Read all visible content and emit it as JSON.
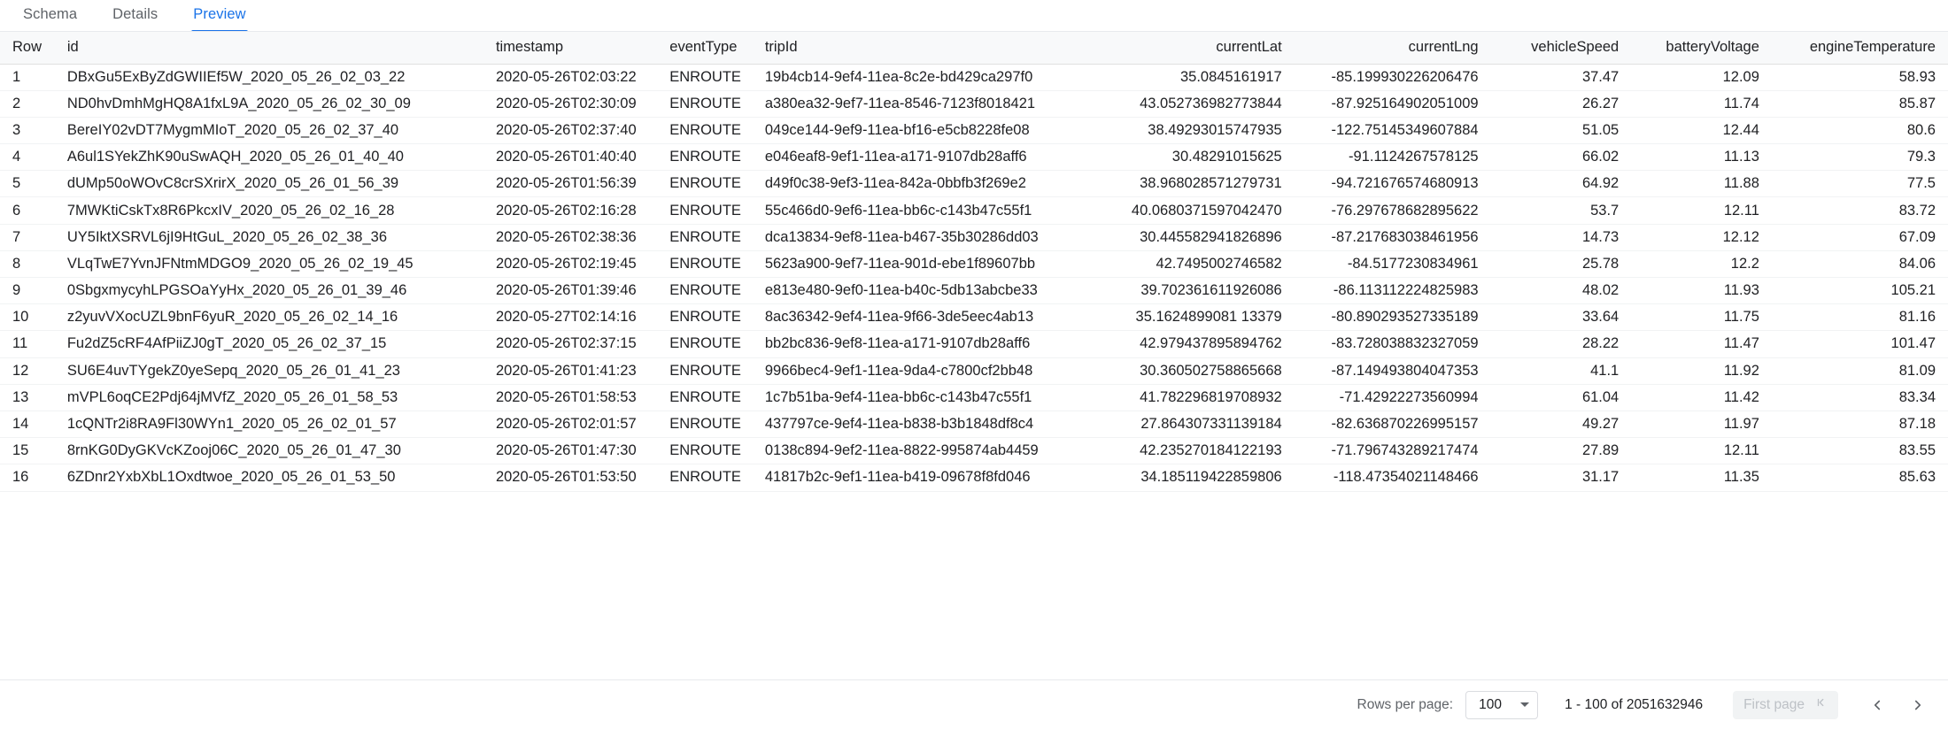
{
  "tabs": [
    {
      "label": "Schema",
      "active": false
    },
    {
      "label": "Details",
      "active": false
    },
    {
      "label": "Preview",
      "active": true
    }
  ],
  "accent_color": "#1a73e8",
  "table": {
    "columns": [
      {
        "key": "row",
        "label": "Row",
        "align": "left"
      },
      {
        "key": "id",
        "label": "id",
        "align": "left"
      },
      {
        "key": "timestamp",
        "label": "timestamp",
        "align": "left"
      },
      {
        "key": "eventType",
        "label": "eventType",
        "align": "left"
      },
      {
        "key": "tripId",
        "label": "tripId",
        "align": "left"
      },
      {
        "key": "currentLat",
        "label": "currentLat",
        "align": "right"
      },
      {
        "key": "currentLng",
        "label": "currentLng",
        "align": "right"
      },
      {
        "key": "vehicleSpeed",
        "label": "vehicleSpeed",
        "align": "right"
      },
      {
        "key": "batteryVoltage",
        "label": "batteryVoltage",
        "align": "right"
      },
      {
        "key": "engineTemperature",
        "label": "engineTemperature",
        "align": "right"
      }
    ],
    "rows": [
      [
        "1",
        "DBxGu5ExByZdGWIIEf5W_2020_05_26_02_03_22",
        "2020-05-26T02:03:22",
        "ENROUTE",
        "19b4cb14-9ef4-11ea-8c2e-bd429ca297f0",
        "35.0845161917",
        "-85.199930226206476",
        "37.47",
        "12.09",
        "58.93"
      ],
      [
        "2",
        "ND0hvDmhMgHQ8A1fxL9A_2020_05_26_02_30_09",
        "2020-05-26T02:30:09",
        "ENROUTE",
        "a380ea32-9ef7-11ea-8546-7123f8018421",
        "43.052736982773844",
        "-87.925164902051009",
        "26.27",
        "11.74",
        "85.87"
      ],
      [
        "3",
        "BereIY02vDT7MygmMIoT_2020_05_26_02_37_40",
        "2020-05-26T02:37:40",
        "ENROUTE",
        "049ce144-9ef9-11ea-bf16-e5cb8228fe08",
        "38.49293015747935",
        "-122.75145349607884",
        "51.05",
        "12.44",
        "80.6"
      ],
      [
        "4",
        "A6ul1SYekZhK90uSwAQH_2020_05_26_01_40_40",
        "2020-05-26T01:40:40",
        "ENROUTE",
        "e046eaf8-9ef1-11ea-a171-9107db28aff6",
        "30.48291015625",
        "-91.1124267578125",
        "66.02",
        "11.13",
        "79.3"
      ],
      [
        "5",
        "dUMp50oWOvC8crSXrirX_2020_05_26_01_56_39",
        "2020-05-26T01:56:39",
        "ENROUTE",
        "d49f0c38-9ef3-11ea-842a-0bbfb3f269e2",
        "38.968028571279731",
        "-94.721676574680913",
        "64.92",
        "11.88",
        "77.5"
      ],
      [
        "6",
        "7MWKtiCskTx8R6PkcxIV_2020_05_26_02_16_28",
        "2020-05-26T02:16:28",
        "ENROUTE",
        "55c466d0-9ef6-11ea-bb6c-c143b47c55f1",
        "40.0680371597042470",
        "-76.297678682895622",
        "53.7",
        "12.11",
        "83.72"
      ],
      [
        "7",
        "UY5IktXSRVL6jI9HtGuL_2020_05_26_02_38_36",
        "2020-05-26T02:38:36",
        "ENROUTE",
        "dca13834-9ef8-11ea-b467-35b30286dd03",
        "30.445582941826896",
        "-87.217683038461956",
        "14.73",
        "12.12",
        "67.09"
      ],
      [
        "8",
        "VLqTwE7YvnJFNtmMDGO9_2020_05_26_02_19_45",
        "2020-05-26T02:19:45",
        "ENROUTE",
        "5623a900-9ef7-11ea-901d-ebe1f89607bb",
        "42.7495002746582",
        "-84.5177230834961",
        "25.78",
        "12.2",
        "84.06"
      ],
      [
        "9",
        "0SbgxmycyhLPGSOaYyHx_2020_05_26_01_39_46",
        "2020-05-26T01:39:46",
        "ENROUTE",
        "e813e480-9ef0-11ea-b40c-5db13abcbe33",
        "39.702361611926086",
        "-86.113112224825983",
        "48.02",
        "11.93",
        "105.21"
      ],
      [
        "10",
        "z2yuvVXocUZL9bnF6yuR_2020_05_26_02_14_16",
        "2020-05-27T02:14:16",
        "ENROUTE",
        "8ac36342-9ef4-11ea-9f66-3de5eec4ab13",
        "35.1624899081 13379",
        "-80.890293527335189",
        "33.64",
        "11.75",
        "81.16"
      ],
      [
        "11",
        "Fu2dZ5cRF4AfPiiZJ0gT_2020_05_26_02_37_15",
        "2020-05-26T02:37:15",
        "ENROUTE",
        "bb2bc836-9ef8-11ea-a171-9107db28aff6",
        "42.979437895894762",
        "-83.728038832327059",
        "28.22",
        "11.47",
        "101.47"
      ],
      [
        "12",
        "SU6E4uvTYgekZ0yeSepq_2020_05_26_01_41_23",
        "2020-05-26T01:41:23",
        "ENROUTE",
        "9966bec4-9ef1-11ea-9da4-c7800cf2bb48",
        "30.360502758865668",
        "-87.149493804047353",
        "41.1",
        "11.92",
        "81.09"
      ],
      [
        "13",
        "mVPL6oqCE2Pdj64jMVfZ_2020_05_26_01_58_53",
        "2020-05-26T01:58:53",
        "ENROUTE",
        "1c7b51ba-9ef4-11ea-bb6c-c143b47c55f1",
        "41.782296819708932",
        "-71.42922273560994",
        "61.04",
        "11.42",
        "83.34"
      ],
      [
        "14",
        "1cQNTr2i8RA9Fl30WYn1_2020_05_26_02_01_57",
        "2020-05-26T02:01:57",
        "ENROUTE",
        "437797ce-9ef4-11ea-b838-b3b1848df8c4",
        "27.864307331139184",
        "-82.636870226995157",
        "49.27",
        "11.97",
        "87.18"
      ],
      [
        "15",
        "8rnKG0DyGKVcKZooj06C_2020_05_26_01_47_30",
        "2020-05-26T01:47:30",
        "ENROUTE",
        "0138c894-9ef2-11ea-8822-995874ab4459",
        "42.235270184122193",
        "-71.796743289217474",
        "27.89",
        "12.11",
        "83.55"
      ],
      [
        "16",
        "6ZDnr2YxbXbL1Oxdtwoe_2020_05_26_01_53_50",
        "2020-05-26T01:53:50",
        "ENROUTE",
        "41817b2c-9ef1-11ea-b419-09678f8fd046",
        "34.185119422859806",
        "-118.47354021148466",
        "31.17",
        "11.35",
        "85.63"
      ]
    ]
  },
  "pagination": {
    "rows_per_page_label": "Rows per page:",
    "rows_per_page_value": "100",
    "range_text": "1 - 100 of 2051632946",
    "first_page_label": "First page",
    "prev_page_icon": "chevron-left-icon",
    "next_page_icon": "chevron-right-icon"
  }
}
